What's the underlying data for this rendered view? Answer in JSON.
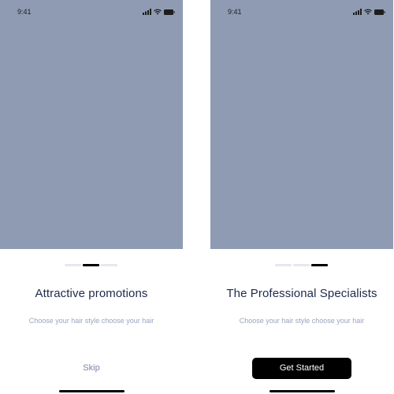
{
  "screens": [
    {
      "status_time": "9:41",
      "title": "Attractive promotions",
      "subtitle": "Choose your hair style choose your hair",
      "action_label": "Skip",
      "active_page": 2,
      "page_count": 3
    },
    {
      "status_time": "9:41",
      "title": "The Professional Specialists",
      "subtitle": "Choose your hair style choose your hair",
      "action_label": "Get Started",
      "active_page": 3,
      "page_count": 3
    }
  ],
  "colors": {
    "hero_placeholder": "#8e9bb3",
    "title": "#1e2a4a",
    "subtitle": "#9aa3c0",
    "skip": "#7b84a8",
    "button_bg": "#000000",
    "indicator_active": "#000000",
    "indicator_inactive": "#e5e8ef"
  },
  "icons": [
    "signal-icon",
    "wifi-icon",
    "battery-icon"
  ]
}
